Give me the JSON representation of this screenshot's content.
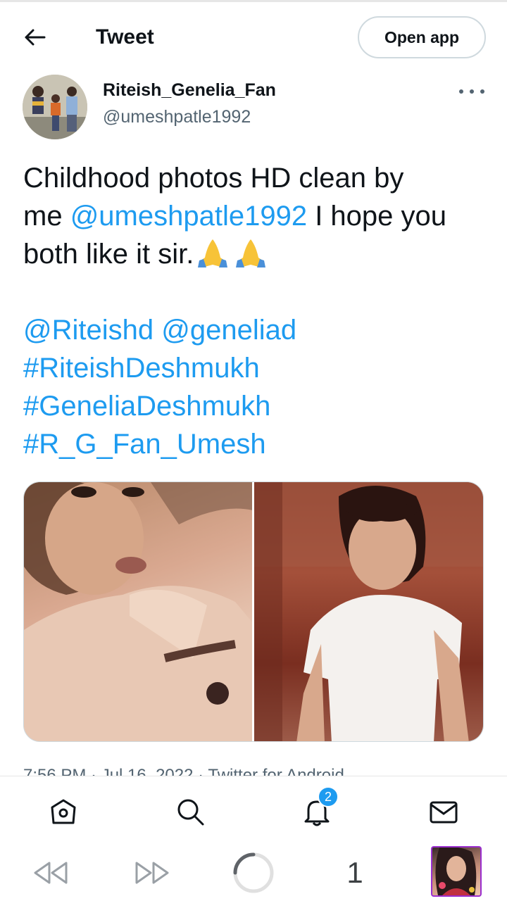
{
  "header": {
    "title": "Tweet",
    "open_app_label": "Open app"
  },
  "author": {
    "name": "Riteish_Genelia_Fan",
    "handle": "@umeshpatle1992"
  },
  "tweet": {
    "line1": "Childhood photos HD clean by",
    "pre_mention": "me ",
    "mention1": "@umeshpatle1992",
    "post_mention": " I hope you both like it sir.",
    "mention2": "@Riteishd",
    "mention3": "@geneliad",
    "hashtag1": "#RiteishDeshmukh",
    "hashtag2": "#GeneliaDeshmukh",
    "hashtag3": "#R_G_Fan_Umesh",
    "emoji": "folded-hands"
  },
  "timestamp": "7:56 PM · Jul 16, 2022 · Twitter for Android",
  "tabbar": {
    "items": [
      "home",
      "search",
      "notifications",
      "messages"
    ],
    "notification_count": "2"
  },
  "system_bar": {
    "tab_count": "1"
  },
  "colors": {
    "link": "#1d9bf0",
    "text": "#0f1419",
    "secondary": "#536471",
    "border": "#cfd9de"
  }
}
